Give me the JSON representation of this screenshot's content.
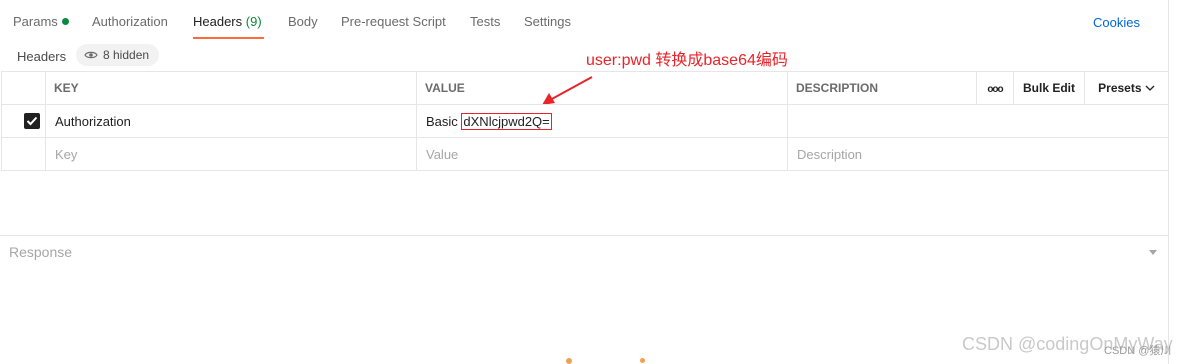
{
  "tabs": [
    {
      "label": "Params"
    },
    {
      "label": "Authorization"
    },
    {
      "label": "Headers",
      "count": "(9)"
    },
    {
      "label": "Body"
    },
    {
      "label": "Pre-request Script"
    },
    {
      "label": "Tests"
    },
    {
      "label": "Settings"
    }
  ],
  "cookies_label": "Cookies",
  "subbar": {
    "label": "Headers",
    "hidden": "8 hidden"
  },
  "annotation": "user:pwd 转换成base64编码",
  "columns": {
    "key": "KEY",
    "value": "VALUE",
    "description": "DESCRIPTION",
    "more": "ooo",
    "bulk_edit": "Bulk Edit",
    "presets": "Presets"
  },
  "rows": [
    {
      "key": "Authorization",
      "value_prefix": "Basic ",
      "value_token": "dXNlcjpwd2Q=",
      "checked": true
    }
  ],
  "placeholders": {
    "key": "Key",
    "value": "Value",
    "description": "Description"
  },
  "response_label": "Response",
  "watermark": "CSDN @codingOnMyWay",
  "watermark_small": "CSDN @猿川",
  "colors": {
    "accent": "#ff6c37",
    "link": "#0265d2",
    "annotation": "#e8242a",
    "success": "#0a8a3c"
  }
}
